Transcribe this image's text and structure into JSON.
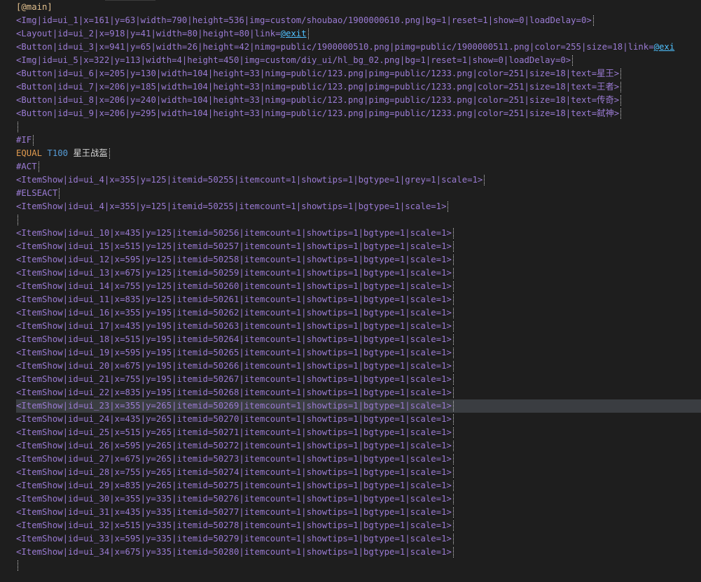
{
  "editor": {
    "lines": [
      {
        "segments": [
          {
            "t": "[@main]",
            "c": "c-bracket"
          }
        ]
      },
      {
        "segments": [
          {
            "t": "<Img|id=ui_1|x=161|y=63|width=790|height=536|img=custom/shoubao/1900000610.png|bg=1|reset=1|show=0|loadDelay=0>",
            "c": "c-tag"
          }
        ],
        "cursor": true
      },
      {
        "segments": [
          {
            "t": "<Layout|id=ui_2|x=918|y=41|width=80|height=80|link=",
            "c": "c-tag"
          },
          {
            "t": "@exit",
            "c": "c-link"
          }
        ],
        "cursor": true
      },
      {
        "segments": [
          {
            "t": "<Button|id=ui_3|x=941|y=65|width=26|height=42|nimg=public/1900000510.png|pimg=public/1900000511.png|color=255|size=18|link=",
            "c": "c-tag"
          },
          {
            "t": "@exi",
            "c": "c-link"
          }
        ]
      },
      {
        "segments": [
          {
            "t": "<Img|id=ui_5|x=322|y=113|width=4|height=450|img=custom/diy_ui/hl_bg_02.png|bg=1|reset=1|show=0|loadDelay=0>",
            "c": "c-tag"
          }
        ],
        "cursor": true
      },
      {
        "segments": [
          {
            "t": "<Button|id=ui_6|x=205|y=130|width=104|height=33|nimg=public/123.png|pimg=public/1233.png|color=251|size=18|text=星王>",
            "c": "c-tag"
          }
        ],
        "cursor": true
      },
      {
        "segments": [
          {
            "t": "<Button|id=ui_7|x=206|y=185|width=104|height=33|nimg=public/123.png|pimg=public/1233.png|color=251|size=18|text=王者>",
            "c": "c-tag"
          }
        ],
        "cursor": true
      },
      {
        "segments": [
          {
            "t": "<Button|id=ui_8|x=206|y=240|width=104|height=33|nimg=public/123.png|pimg=public/1233.png|color=251|size=18|text=传奇>",
            "c": "c-tag"
          }
        ],
        "cursor": true
      },
      {
        "segments": [
          {
            "t": "<Button|id=ui_9|x=206|y=295|width=104|height=33|nimg=public/123.png|pimg=public/1233.png|color=251|size=18|text=弑神>",
            "c": "c-tag"
          }
        ],
        "cursor": true
      },
      {
        "segments": [
          {
            "t": "",
            "c": "c-tag"
          }
        ],
        "cursor": true
      },
      {
        "segments": [
          {
            "t": "#IF",
            "c": "c-purple"
          }
        ],
        "cursor": true
      },
      {
        "segments": [
          {
            "t": "EQUAL ",
            "c": "c-orange"
          },
          {
            "t": "T100 ",
            "c": "c-blue"
          },
          {
            "t": "星王战盔",
            "c": "c-text"
          }
        ],
        "cursor": true
      },
      {
        "segments": [
          {
            "t": "#ACT",
            "c": "c-purple"
          }
        ],
        "cursor": true
      },
      {
        "segments": [
          {
            "t": "<ItemShow|id=ui_4|x=355|y=125|itemid=50255|itemcount=1|showtips=1|bgtype=1|grey=1|scale=1>",
            "c": "c-tag"
          }
        ],
        "cursor": true
      },
      {
        "segments": [
          {
            "t": "#ELSEACT",
            "c": "c-purple"
          }
        ],
        "cursor": true
      },
      {
        "segments": [
          {
            "t": "<ItemShow|id=ui_4|x=355|y=125|itemid=50255|itemcount=1|showtips=1|bgtype=1|scale=1>",
            "c": "c-tag"
          }
        ],
        "cursor": true
      },
      {
        "segments": [
          {
            "t": "",
            "c": "c-tag"
          }
        ],
        "cursor": true
      },
      {
        "segments": [
          {
            "t": "<ItemShow|id=ui_10|x=435|y=125|itemid=50256|itemcount=1|showtips=1|bgtype=1|scale=1>",
            "c": "c-tag"
          }
        ],
        "cursor": true
      },
      {
        "segments": [
          {
            "t": "<ItemShow|id=ui_15|x=515|y=125|itemid=50257|itemcount=1|showtips=1|bgtype=1|scale=1>",
            "c": "c-tag"
          }
        ],
        "cursor": true
      },
      {
        "segments": [
          {
            "t": "<ItemShow|id=ui_12|x=595|y=125|itemid=50258|itemcount=1|showtips=1|bgtype=1|scale=1>",
            "c": "c-tag"
          }
        ],
        "cursor": true
      },
      {
        "segments": [
          {
            "t": "<ItemShow|id=ui_13|x=675|y=125|itemid=50259|itemcount=1|showtips=1|bgtype=1|scale=1>",
            "c": "c-tag"
          }
        ],
        "cursor": true
      },
      {
        "segments": [
          {
            "t": "<ItemShow|id=ui_14|x=755|y=125|itemid=50260|itemcount=1|showtips=1|bgtype=1|scale=1>",
            "c": "c-tag"
          }
        ],
        "cursor": true
      },
      {
        "segments": [
          {
            "t": "<ItemShow|id=ui_11|x=835|y=125|itemid=50261|itemcount=1|showtips=1|bgtype=1|scale=1>",
            "c": "c-tag"
          }
        ],
        "cursor": true
      },
      {
        "segments": [
          {
            "t": "<ItemShow|id=ui_16|x=355|y=195|itemid=50262|itemcount=1|showtips=1|bgtype=1|scale=1>",
            "c": "c-tag"
          }
        ],
        "cursor": true
      },
      {
        "segments": [
          {
            "t": "<ItemShow|id=ui_17|x=435|y=195|itemid=50263|itemcount=1|showtips=1|bgtype=1|scale=1>",
            "c": "c-tag"
          }
        ],
        "cursor": true
      },
      {
        "segments": [
          {
            "t": "<ItemShow|id=ui_18|x=515|y=195|itemid=50264|itemcount=1|showtips=1|bgtype=1|scale=1>",
            "c": "c-tag"
          }
        ],
        "cursor": true
      },
      {
        "segments": [
          {
            "t": "<ItemShow|id=ui_19|x=595|y=195|itemid=50265|itemcount=1|showtips=1|bgtype=1|scale=1>",
            "c": "c-tag"
          }
        ],
        "cursor": true
      },
      {
        "segments": [
          {
            "t": "<ItemShow|id=ui_20|x=675|y=195|itemid=50266|itemcount=1|showtips=1|bgtype=1|scale=1>",
            "c": "c-tag"
          }
        ],
        "cursor": true
      },
      {
        "segments": [
          {
            "t": "<ItemShow|id=ui_21|x=755|y=195|itemid=50267|itemcount=1|showtips=1|bgtype=1|scale=1>",
            "c": "c-tag"
          }
        ],
        "cursor": true
      },
      {
        "segments": [
          {
            "t": "<ItemShow|id=ui_22|x=835|y=195|itemid=50268|itemcount=1|showtips=1|bgtype=1|scale=1>",
            "c": "c-tag"
          }
        ],
        "cursor": true
      },
      {
        "segments": [
          {
            "t": "<ItemShow|id=ui_23|x=355|y=265|itemid=50269|itemcount=1|showtips=1|bgtype=1|scale=1>",
            "c": "c-tag"
          }
        ],
        "cursor": true,
        "highlight": true
      },
      {
        "segments": [
          {
            "t": "<ItemShow|id=ui_24|x=435|y=265|itemid=50270|itemcount=1|showtips=1|bgtype=1|scale=1>",
            "c": "c-tag"
          }
        ],
        "cursor": true
      },
      {
        "segments": [
          {
            "t": "<ItemShow|id=ui_25|x=515|y=265|itemid=50271|itemcount=1|showtips=1|bgtype=1|scale=1>",
            "c": "c-tag"
          }
        ],
        "cursor": true
      },
      {
        "segments": [
          {
            "t": "<ItemShow|id=ui_26|x=595|y=265|itemid=50272|itemcount=1|showtips=1|bgtype=1|scale=1>",
            "c": "c-tag"
          }
        ],
        "cursor": true
      },
      {
        "segments": [
          {
            "t": "<ItemShow|id=ui_27|x=675|y=265|itemid=50273|itemcount=1|showtips=1|bgtype=1|scale=1>",
            "c": "c-tag"
          }
        ],
        "cursor": true
      },
      {
        "segments": [
          {
            "t": "<ItemShow|id=ui_28|x=755|y=265|itemid=50274|itemcount=1|showtips=1|bgtype=1|scale=1>",
            "c": "c-tag"
          }
        ],
        "cursor": true
      },
      {
        "segments": [
          {
            "t": "<ItemShow|id=ui_29|x=835|y=265|itemid=50275|itemcount=1|showtips=1|bgtype=1|scale=1>",
            "c": "c-tag"
          }
        ],
        "cursor": true
      },
      {
        "segments": [
          {
            "t": "<ItemShow|id=ui_30|x=355|y=335|itemid=50276|itemcount=1|showtips=1|bgtype=1|scale=1>",
            "c": "c-tag"
          }
        ],
        "cursor": true
      },
      {
        "segments": [
          {
            "t": "<ItemShow|id=ui_31|x=435|y=335|itemid=50277|itemcount=1|showtips=1|bgtype=1|scale=1>",
            "c": "c-tag"
          }
        ],
        "cursor": true
      },
      {
        "segments": [
          {
            "t": "<ItemShow|id=ui_32|x=515|y=335|itemid=50278|itemcount=1|showtips=1|bgtype=1|scale=1>",
            "c": "c-tag"
          }
        ],
        "cursor": true
      },
      {
        "segments": [
          {
            "t": "<ItemShow|id=ui_33|x=595|y=335|itemid=50279|itemcount=1|showtips=1|bgtype=1|scale=1>",
            "c": "c-tag"
          }
        ],
        "cursor": true
      },
      {
        "segments": [
          {
            "t": "<ItemShow|id=ui_34|x=675|y=335|itemid=50280|itemcount=1|showtips=1|bgtype=1|scale=1>",
            "c": "c-tag"
          }
        ],
        "cursor": true
      },
      {
        "segments": [
          {
            "t": "",
            "c": "c-tag"
          }
        ],
        "cursor": true
      }
    ]
  }
}
